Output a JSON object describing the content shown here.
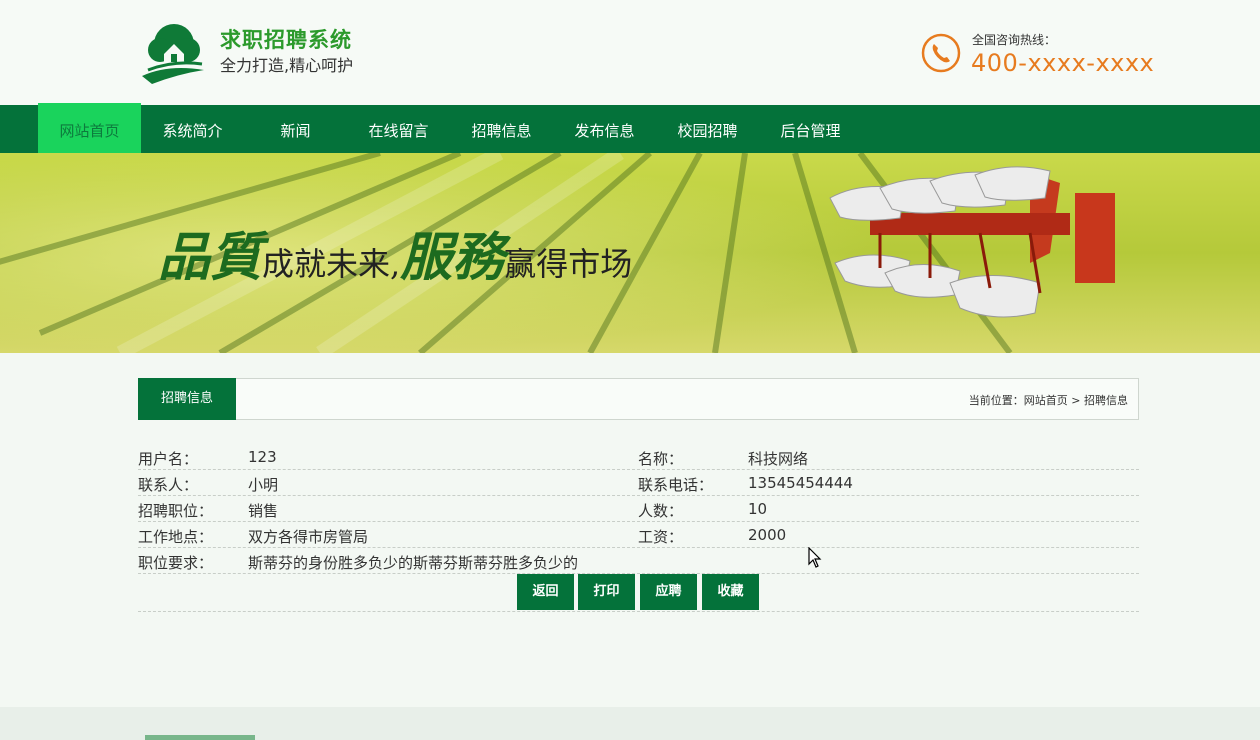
{
  "header": {
    "title": "求职招聘系统",
    "slogan": "全力打造,精心呵护",
    "hotline_label": "全国咨询热线：",
    "hotline_number": "400-xxxx-xxxx"
  },
  "nav": {
    "items": [
      {
        "label": "网站首页"
      },
      {
        "label": "系统简介"
      },
      {
        "label": "新闻"
      },
      {
        "label": "在线留言"
      },
      {
        "label": "招聘信息"
      },
      {
        "label": "发布信息"
      },
      {
        "label": "校园招聘"
      },
      {
        "label": "后台管理"
      }
    ]
  },
  "banner": {
    "slogan_a": "品質",
    "slogan_b": "成就未来,",
    "slogan_c": "服務",
    "slogan_d": "赢得市场"
  },
  "content": {
    "tab_label": "招聘信息",
    "breadcrumb": "当前位置：网站首页 > 招聘信息"
  },
  "details": {
    "username_label": "用户名：",
    "username": "123",
    "company_label": "名称：",
    "company": "科技网络",
    "contact_label": "联系人：",
    "contact": "小明",
    "phone_label": "联系电话：",
    "phone": "13545454444",
    "position_label": "招聘职位：",
    "position": "销售",
    "headcount_label": "人数：",
    "headcount": "10",
    "location_label": "工作地点：",
    "location": "双方各得市房管局",
    "salary_label": "工资：",
    "salary": "2000",
    "requirements_label": "职位要求：",
    "requirements": "斯蒂芬的身份胜多负少的斯蒂芬斯蒂芬胜多负少的"
  },
  "actions": {
    "back": "返回",
    "print": "打印",
    "apply": "应聘",
    "favorite": "收藏"
  }
}
